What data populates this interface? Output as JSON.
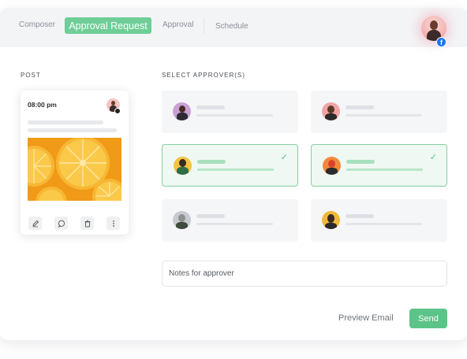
{
  "header": {
    "tabs": {
      "composer": "Composer",
      "approval_request": "Approval Request",
      "approval": "Approval",
      "schedule": "Schedule"
    },
    "active_tab": "Approval Request",
    "profile_network_icon": "facebook-icon",
    "fb_glyph": "f"
  },
  "post": {
    "section_label": "POST",
    "time": "08:00 pm",
    "image": "orange-slices",
    "actions": [
      "edit-icon",
      "comment-icon",
      "trash-icon",
      "more-icon"
    ]
  },
  "approvers": {
    "section_label": "SELECT APPROVER(S)",
    "items": [
      {
        "selected": false
      },
      {
        "selected": false
      },
      {
        "selected": true
      },
      {
        "selected": true
      },
      {
        "selected": false
      },
      {
        "selected": false
      }
    ]
  },
  "notes": {
    "placeholder": "Notes for approver"
  },
  "footer": {
    "preview_label": "Preview Email",
    "send_label": "Send"
  },
  "colors": {
    "accent": "#5cc488",
    "tab_active": "#6fce97",
    "facebook": "#1877f2"
  }
}
